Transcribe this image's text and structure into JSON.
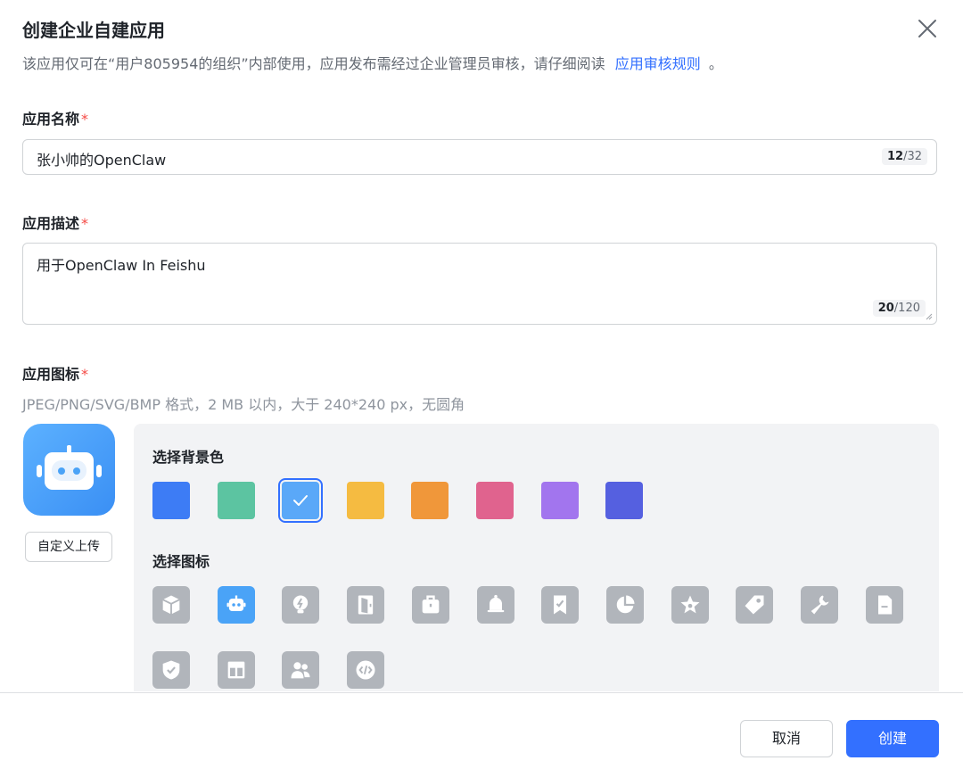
{
  "dialog": {
    "title": "创建企业自建应用",
    "subtitle_text": "该应用仅可在“用户805954的组织”内部使用，应用发布需经过企业管理员审核，请仔细阅读",
    "subtitle_link": "应用审核规则",
    "subtitle_end": "。"
  },
  "name_field": {
    "label": "应用名称",
    "required_mark": "*",
    "value": "张小帅的OpenClaw",
    "count": "12",
    "max": "/32"
  },
  "desc_field": {
    "label": "应用描述",
    "required_mark": "*",
    "value": "用于OpenClaw In Feishu",
    "count": "20",
    "max": "/120"
  },
  "icon_field": {
    "label": "应用图标",
    "required_mark": "*",
    "hint": "JPEG/PNG/SVG/BMP 格式，2 MB 以内，大于 240*240 px，无圆角",
    "upload_label": "自定义上传",
    "bg_label": "选择背景色",
    "icon_label": "选择图标",
    "bg_colors": [
      "#3d7cf5",
      "#5cc4a1",
      "#5aa8f8",
      "#f5bb41",
      "#f0973a",
      "#e0638e",
      "#a275ee",
      "#5560e0"
    ],
    "selected_bg_index": 2,
    "icons": [
      "cube-icon",
      "robot-icon",
      "bulb-icon",
      "door-icon",
      "briefcase-icon",
      "bell-icon",
      "bookmark-icon",
      "pie-chart-icon",
      "star-icon",
      "tag-icon",
      "wrench-icon",
      "document-icon",
      "shield-icon",
      "layout-icon",
      "users-icon",
      "code-icon"
    ],
    "selected_icon_index": 1
  },
  "footer": {
    "cancel_label": "取消",
    "create_label": "创建"
  },
  "colors": {
    "primary": "#3370ff",
    "required": "#f54a45"
  }
}
